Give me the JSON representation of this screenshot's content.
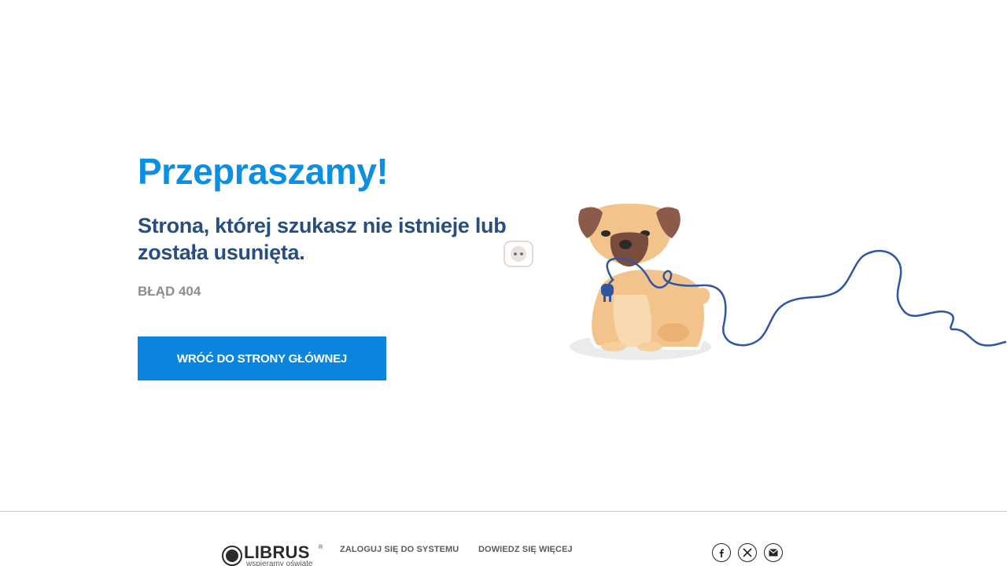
{
  "main": {
    "headline": "Przepraszamy!",
    "subhead": "Strona, której szukasz nie istnieje lub została usunięta.",
    "error_code": "BŁĄD 404",
    "home_button_label": "WRÓĆ DO STRONY GŁÓWNEJ"
  },
  "illustration": {
    "subject": "dog-with-unplugged-cable",
    "icon": "dog-icon"
  },
  "footer": {
    "logo_text": "LIBRUS",
    "logo_registered": "®",
    "logo_tagline": "wspieramy oświatę",
    "links": [
      {
        "label": "ZALOGUJ SIĘ DO SYSTEMU"
      },
      {
        "label": "DOWIEDZ SIĘ WIĘCEJ"
      }
    ],
    "social": [
      {
        "icon": "facebook-icon"
      },
      {
        "icon": "x-twitter-icon"
      },
      {
        "icon": "mail-icon"
      }
    ]
  },
  "colors": {
    "headline": "#0a8fe2",
    "subhead": "#284e7f",
    "button_bg": "#0a85de",
    "muted": "#8e8e8e"
  }
}
